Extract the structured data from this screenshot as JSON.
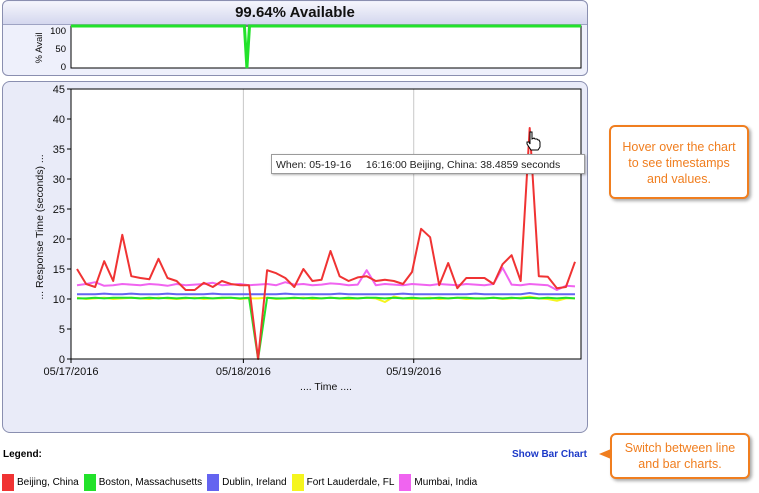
{
  "availability": {
    "title": "99.64% Available",
    "ylabel": "% Avail",
    "ticks": [
      "100",
      "50",
      "0"
    ]
  },
  "chart_data": [
    {
      "type": "line",
      "title": "99.64% Available",
      "ylabel": "% Avail",
      "ylim": [
        0,
        100
      ],
      "series": [
        {
          "name": "Boston, Massachusetts",
          "color": "#22e22a",
          "points": [
            [
              0,
              100
            ],
            [
              0.34,
              100
            ],
            [
              0.345,
              0
            ],
            [
              0.35,
              100
            ],
            [
              1,
              100
            ]
          ]
        }
      ]
    },
    {
      "type": "line",
      "xlabel": ".... Time ....",
      "ylabel": "... Response Time (seconds) ...",
      "ylim": [
        0,
        45
      ],
      "yticks": [
        0,
        5,
        10,
        15,
        20,
        25,
        30,
        35,
        40,
        45
      ],
      "xticks": [
        "05/17/2016",
        "05/18/2016",
        "05/19/2016"
      ],
      "grid": true,
      "series": [
        {
          "name": "Beijing, China",
          "color": "#f03333",
          "values": [
            15,
            12.5,
            12,
            16.3,
            13,
            20.7,
            13.8,
            13.5,
            13.3,
            16.7,
            13.5,
            13,
            11.5,
            11.5,
            12.7,
            12,
            13,
            12.5,
            12.3,
            12.3,
            0,
            14.8,
            14.3,
            13.5,
            12,
            15,
            13,
            13.2,
            18,
            13.8,
            13,
            13.6,
            13.8,
            13,
            13.2,
            13,
            12.5,
            14.5,
            21.7,
            20.3,
            12.3,
            16,
            11.8,
            13.5,
            13.5,
            13.5,
            12.5,
            15.8,
            17.3,
            13,
            38.5,
            13.8,
            13.7,
            11.8,
            12,
            16.2
          ]
        },
        {
          "name": "Boston, Massachusetts",
          "color": "#22e22a",
          "values": [
            10.1,
            10.1,
            10.2,
            10.1,
            10.2,
            10.2,
            10.2,
            10.1,
            10.2,
            10.1,
            10.2,
            10.1,
            10.2,
            10.1,
            10.2,
            10.1,
            10.2,
            10.2,
            10.1,
            10.2,
            0,
            10.2,
            10.1,
            10.1,
            10.2,
            10.1,
            10.2,
            10.1,
            10.2,
            10.1,
            10.2,
            10.1,
            10.2,
            10.2,
            10.1,
            10.2,
            10.1,
            10.2,
            10.1,
            10.1,
            10.2,
            10.1,
            10.2,
            10.2,
            10.1,
            10.1,
            10.2,
            10.1,
            10.2,
            10.1,
            10.2,
            10.1,
            10.2,
            10.1,
            10.2,
            10.1
          ]
        },
        {
          "name": "Dublin, Ireland",
          "color": "#6464f0",
          "values": [
            10.8,
            10.8,
            10.8,
            10.9,
            10.8,
            10.8,
            10.9,
            10.8,
            10.8,
            10.8,
            10.9,
            10.8,
            10.8,
            10.8,
            10.8,
            10.9,
            10.8,
            10.8,
            10.8,
            10.8,
            10.8,
            10.8,
            10.8,
            10.9,
            10.8,
            10.8,
            10.8,
            10.8,
            10.8,
            10.9,
            10.8,
            10.8,
            10.8,
            10.8,
            10.8,
            10.8,
            10.9,
            10.8,
            10.8,
            10.8,
            10.8,
            10.8,
            10.8,
            10.8,
            10.9,
            10.8,
            10.8,
            10.8,
            10.8,
            10.8,
            11,
            10.8,
            10.8,
            10.8,
            10.8,
            10.8
          ]
        },
        {
          "name": "Fort Lauderdale, FL",
          "color": "#f5f51e",
          "values": [
            10.2,
            10,
            10.1,
            10.2,
            10,
            10.1,
            10.2,
            10.1,
            10,
            10.2,
            10.1,
            10,
            10.1,
            10.2,
            10,
            10.1,
            10.1,
            10.2,
            10,
            10.1,
            10.1,
            10.2,
            10,
            10.1,
            10.1,
            10.2,
            10,
            10.1,
            10.2,
            10.1,
            10,
            10.1,
            10.2,
            10.1,
            9.5,
            10.4,
            10.1,
            10,
            10.1,
            10.2,
            10,
            10.1,
            10.2,
            10,
            10.1,
            10.1,
            10.2,
            10,
            10.1,
            10.2,
            10.4,
            10.1,
            10,
            9.7,
            10.1,
            10.1
          ]
        },
        {
          "name": "Mumbai, India",
          "color": "#f064f0",
          "values": [
            12.3,
            12.5,
            12.8,
            12.2,
            12.3,
            12.5,
            12.4,
            12.3,
            12.5,
            12.4,
            12.2,
            12.5,
            12.3,
            12.4,
            12.5,
            12.7,
            12.3,
            12.4,
            12.5,
            12.3,
            12.4,
            12.5,
            12.3,
            12.8,
            12.4,
            12.5,
            12.3,
            12.4,
            12.6,
            12.5,
            12.3,
            12.4,
            14.8,
            12.3,
            12.5,
            12.4,
            12.3,
            12.5,
            12.4,
            12.3,
            12.5,
            12.4,
            12.3,
            12.5,
            12.4,
            12.3,
            12.5,
            15.2,
            12.4,
            12.3,
            12.5,
            12.4,
            12.3,
            11.5,
            12.2,
            12.1
          ]
        }
      ]
    }
  ],
  "tooltip": {
    "text": "When: 05-19-16     16:16:00 Beijing, China: 38.4859 seconds"
  },
  "callouts": {
    "hover": "Hover over the chart to see timestamps and values.",
    "switch": "Switch between line and bar charts."
  },
  "legend": {
    "title": "Legend:",
    "items": [
      {
        "label": "Beijing, China",
        "color": "#f03333"
      },
      {
        "label": "Boston, Massachusetts",
        "color": "#22e22a"
      },
      {
        "label": "Dublin, Ireland",
        "color": "#6464f0"
      },
      {
        "label": "Fort Lauderdale, FL",
        "color": "#f5f51e"
      },
      {
        "label": "Mumbai, India",
        "color": "#f064f0"
      }
    ]
  },
  "show_bar_chart": "Show Bar Chart",
  "cursor_icon": "hand-pointer-icon"
}
